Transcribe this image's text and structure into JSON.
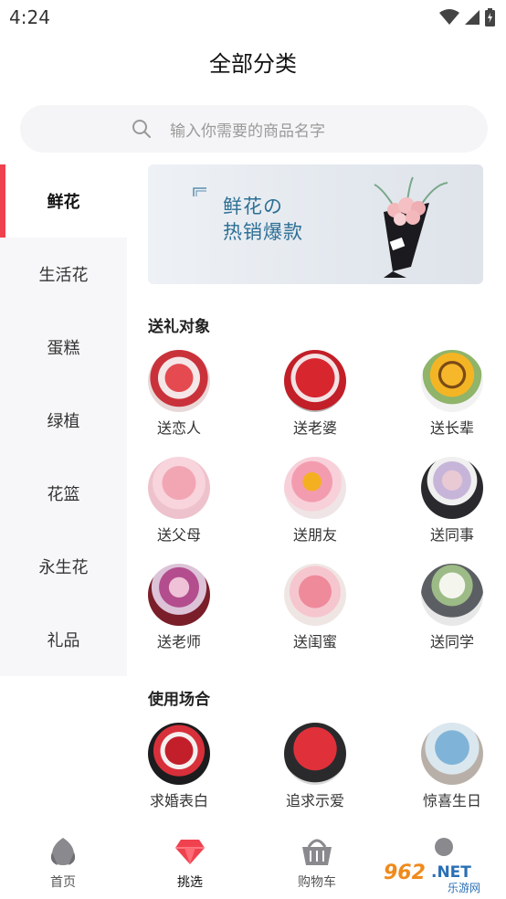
{
  "status": {
    "time": "4:24"
  },
  "header": {
    "title": "全部分类"
  },
  "search": {
    "placeholder": "输入你需要的商品名字"
  },
  "sidebar": {
    "items": [
      {
        "label": "鲜花",
        "active": true
      },
      {
        "label": "生活花",
        "active": false
      },
      {
        "label": "蛋糕",
        "active": false
      },
      {
        "label": "绿植",
        "active": false
      },
      {
        "label": "花篮",
        "active": false
      },
      {
        "label": "永生花",
        "active": false
      },
      {
        "label": "礼品",
        "active": false
      }
    ]
  },
  "banner": {
    "line1": "鲜花の",
    "line2": "热销爆款"
  },
  "sections": [
    {
      "title": "送礼对象",
      "items": [
        {
          "label": "送恋人",
          "flower": "red-roses"
        },
        {
          "label": "送老婆",
          "flower": "red-roses-large"
        },
        {
          "label": "送长辈",
          "flower": "sunflowers"
        },
        {
          "label": "送父母",
          "flower": "pink-roses"
        },
        {
          "label": "送朋友",
          "flower": "sunflower-mix"
        },
        {
          "label": "送同事",
          "flower": "pastel-mix"
        },
        {
          "label": "送老师",
          "flower": "lilies"
        },
        {
          "label": "送闺蜜",
          "flower": "pink-carnations"
        },
        {
          "label": "送同学",
          "flower": "white-roses"
        }
      ]
    },
    {
      "title": "使用场合",
      "items": [
        {
          "label": "求婚表白",
          "flower": "red-roses-babybreath"
        },
        {
          "label": "追求示爱",
          "flower": "red-roses-dark"
        },
        {
          "label": "惊喜生日",
          "flower": "blue-roses"
        }
      ]
    }
  ],
  "tabbar": {
    "items": [
      {
        "label": "首页",
        "icon": "flower-bud-icon"
      },
      {
        "label": "挑选",
        "icon": "gem-icon",
        "active": true
      },
      {
        "label": "购物车",
        "icon": "basket-icon"
      },
      {
        "label": "",
        "icon": "user-icon"
      }
    ]
  },
  "watermark": {
    "text": "962.NET",
    "sub": "乐游网"
  },
  "colors": {
    "accent": "#f0414e",
    "banner_text": "#2d6f95"
  }
}
